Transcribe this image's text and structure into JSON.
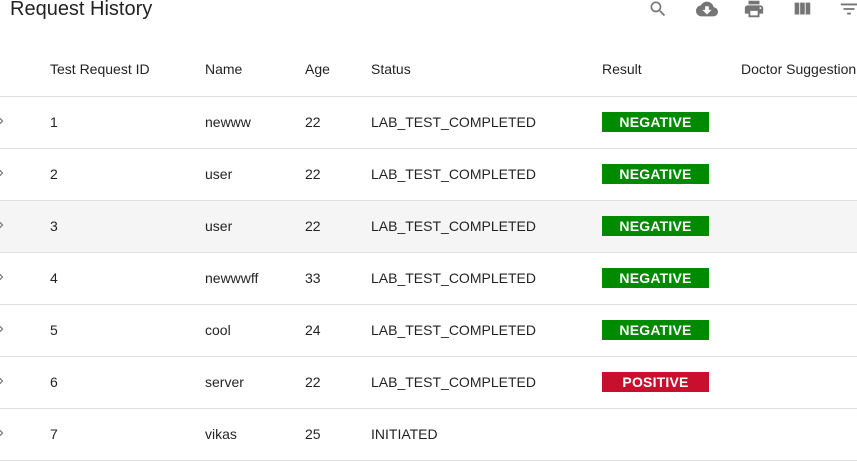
{
  "toolbar": {
    "title": "Request History",
    "icons": [
      "search-icon",
      "cloud-download-icon",
      "print-icon",
      "view-column-icon",
      "filter-list-icon"
    ]
  },
  "table": {
    "columns": [
      "Test Request ID",
      "Name",
      "Age",
      "Status",
      "Result",
      "Doctor Suggestion"
    ],
    "rows": [
      {
        "id": "1",
        "name": "newww",
        "age": "22",
        "status": "LAB_TEST_COMPLETED",
        "result": "NEGATIVE",
        "doctor": ""
      },
      {
        "id": "2",
        "name": "user",
        "age": "22",
        "status": "LAB_TEST_COMPLETED",
        "result": "NEGATIVE",
        "doctor": ""
      },
      {
        "id": "3",
        "name": "user",
        "age": "22",
        "status": "LAB_TEST_COMPLETED",
        "result": "NEGATIVE",
        "doctor": ""
      },
      {
        "id": "4",
        "name": "newwwff",
        "age": "33",
        "status": "LAB_TEST_COMPLETED",
        "result": "NEGATIVE",
        "doctor": ""
      },
      {
        "id": "5",
        "name": "cool",
        "age": "24",
        "status": "LAB_TEST_COMPLETED",
        "result": "NEGATIVE",
        "doctor": ""
      },
      {
        "id": "6",
        "name": "server",
        "age": "22",
        "status": "LAB_TEST_COMPLETED",
        "result": "POSITIVE",
        "doctor": ""
      },
      {
        "id": "7",
        "name": "vikas",
        "age": "25",
        "status": "INITIATED",
        "result": "",
        "doctor": ""
      }
    ]
  },
  "colors": {
    "negative": "#008a00",
    "positive": "#c8102e",
    "hover_row": "#f5f5f5",
    "icon": "#757575"
  }
}
